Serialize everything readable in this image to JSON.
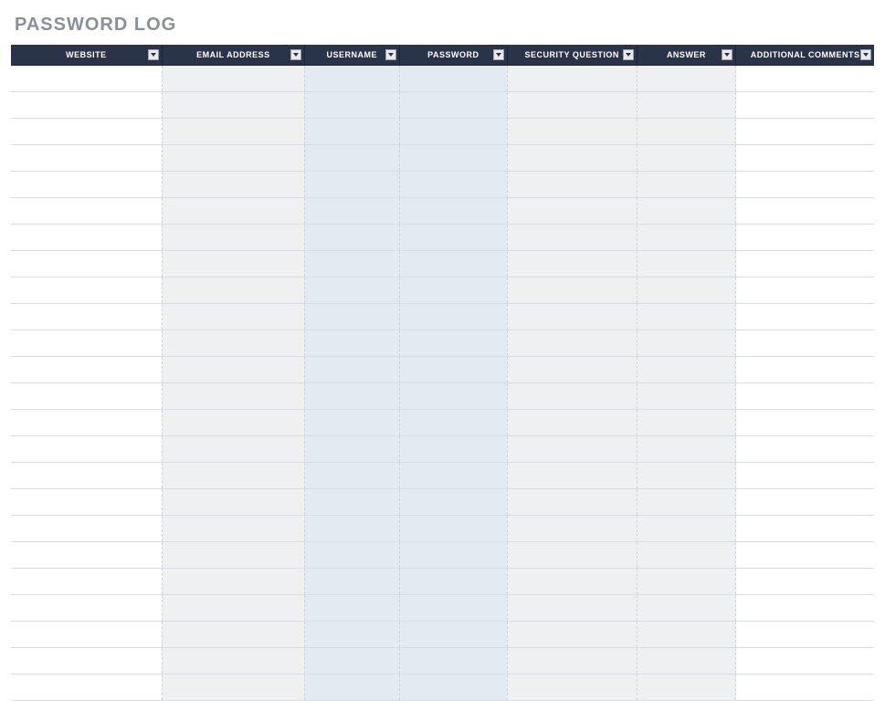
{
  "title": "PASSWORD LOG",
  "columns": {
    "website": {
      "label": "WEBSITE"
    },
    "email": {
      "label": "EMAIL ADDRESS"
    },
    "username": {
      "label": "USERNAME"
    },
    "password": {
      "label": "PASSWORD"
    },
    "secq": {
      "label": "SECURITY QUESTION"
    },
    "answer": {
      "label": "ANSWER"
    },
    "comments": {
      "label": "ADDITIONAL COMMENTS"
    }
  },
  "row_count": 24,
  "rows": [
    {
      "website": "",
      "email": "",
      "username": "",
      "password": "",
      "secq": "",
      "answer": "",
      "comments": ""
    },
    {
      "website": "",
      "email": "",
      "username": "",
      "password": "",
      "secq": "",
      "answer": "",
      "comments": ""
    },
    {
      "website": "",
      "email": "",
      "username": "",
      "password": "",
      "secq": "",
      "answer": "",
      "comments": ""
    },
    {
      "website": "",
      "email": "",
      "username": "",
      "password": "",
      "secq": "",
      "answer": "",
      "comments": ""
    },
    {
      "website": "",
      "email": "",
      "username": "",
      "password": "",
      "secq": "",
      "answer": "",
      "comments": ""
    },
    {
      "website": "",
      "email": "",
      "username": "",
      "password": "",
      "secq": "",
      "answer": "",
      "comments": ""
    },
    {
      "website": "",
      "email": "",
      "username": "",
      "password": "",
      "secq": "",
      "answer": "",
      "comments": ""
    },
    {
      "website": "",
      "email": "",
      "username": "",
      "password": "",
      "secq": "",
      "answer": "",
      "comments": ""
    },
    {
      "website": "",
      "email": "",
      "username": "",
      "password": "",
      "secq": "",
      "answer": "",
      "comments": ""
    },
    {
      "website": "",
      "email": "",
      "username": "",
      "password": "",
      "secq": "",
      "answer": "",
      "comments": ""
    },
    {
      "website": "",
      "email": "",
      "username": "",
      "password": "",
      "secq": "",
      "answer": "",
      "comments": ""
    },
    {
      "website": "",
      "email": "",
      "username": "",
      "password": "",
      "secq": "",
      "answer": "",
      "comments": ""
    },
    {
      "website": "",
      "email": "",
      "username": "",
      "password": "",
      "secq": "",
      "answer": "",
      "comments": ""
    },
    {
      "website": "",
      "email": "",
      "username": "",
      "password": "",
      "secq": "",
      "answer": "",
      "comments": ""
    },
    {
      "website": "",
      "email": "",
      "username": "",
      "password": "",
      "secq": "",
      "answer": "",
      "comments": ""
    },
    {
      "website": "",
      "email": "",
      "username": "",
      "password": "",
      "secq": "",
      "answer": "",
      "comments": ""
    },
    {
      "website": "",
      "email": "",
      "username": "",
      "password": "",
      "secq": "",
      "answer": "",
      "comments": ""
    },
    {
      "website": "",
      "email": "",
      "username": "",
      "password": "",
      "secq": "",
      "answer": "",
      "comments": ""
    },
    {
      "website": "",
      "email": "",
      "username": "",
      "password": "",
      "secq": "",
      "answer": "",
      "comments": ""
    },
    {
      "website": "",
      "email": "",
      "username": "",
      "password": "",
      "secq": "",
      "answer": "",
      "comments": ""
    },
    {
      "website": "",
      "email": "",
      "username": "",
      "password": "",
      "secq": "",
      "answer": "",
      "comments": ""
    },
    {
      "website": "",
      "email": "",
      "username": "",
      "password": "",
      "secq": "",
      "answer": "",
      "comments": ""
    },
    {
      "website": "",
      "email": "",
      "username": "",
      "password": "",
      "secq": "",
      "answer": "",
      "comments": ""
    },
    {
      "website": "",
      "email": "",
      "username": "",
      "password": "",
      "secq": "",
      "answer": "",
      "comments": ""
    }
  ]
}
